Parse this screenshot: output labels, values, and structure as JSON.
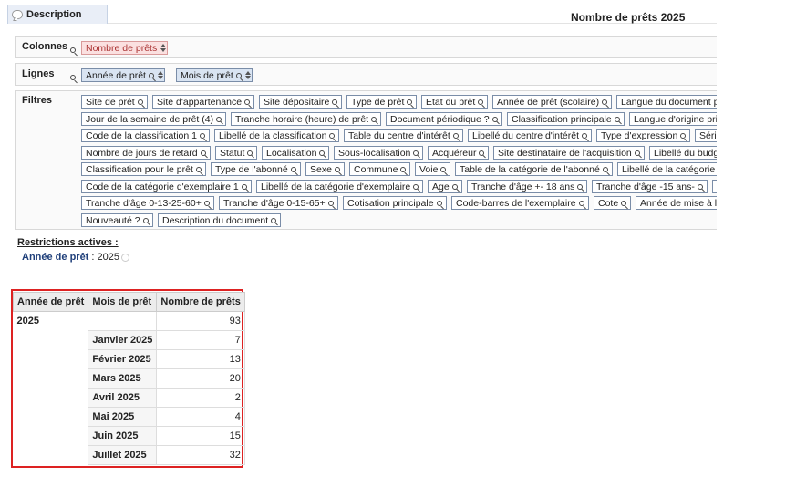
{
  "tab": {
    "description_label": "Description"
  },
  "page_title": "Nombre de prêts 2025",
  "colonnes": {
    "label": "Colonnes",
    "chips": [
      "Nombre de prêts"
    ]
  },
  "lignes": {
    "label": "Lignes",
    "chips": [
      "Année de prêt",
      "Mois de prêt"
    ]
  },
  "filtres": {
    "label": "Filtres",
    "rows": [
      [
        "Site de prêt",
        "Site d'appartenance",
        "Site dépositaire",
        "Type de prêt",
        "Etat du prêt",
        "Année de prêt (scolaire)",
        "Langue du document prêté"
      ],
      [
        "Jour de la semaine de prêt (4)",
        "Tranche horaire (heure) de prêt",
        "Document périodique ?",
        "Classification principale",
        "Langue d'origine principale"
      ],
      [
        "Code de la classification 1",
        "Libellé de la classification",
        "Table du centre d'intérêt",
        "Libellé du centre d'intérêt",
        "Type d'expression",
        "Série"
      ],
      [
        "Nombre de jours de retard",
        "Statut",
        "Localisation",
        "Sous-localisation",
        "Acquéreur",
        "Site destinataire de l'acquisition",
        "Libellé du budget"
      ],
      [
        "Classification pour le prêt",
        "Type de l'abonné",
        "Sexe",
        "Commune",
        "Voie",
        "Table de la catégorie de l'abonné",
        "Libellé de la catégorie"
      ],
      [
        "Code de la catégorie d'exemplaire 1",
        "Libellé de la catégorie d'exemplaire",
        "Age",
        "Tranche d'âge +- 18 ans",
        "Tranche d'âge -15 ans-",
        ""
      ],
      [
        "Tranche d'âge 0-13-25-60+",
        "Tranche d'âge 0-15-65+",
        "Cotisation principale",
        "Code-barres de l'exemplaire",
        "Cote",
        "Année de mise à l'inventaire"
      ],
      [
        "Nouveauté ?",
        "Description du document"
      ]
    ]
  },
  "restrictions": {
    "title": "Restrictions actives :",
    "key": "Année de prêt",
    "sep": " : ",
    "value": "2025"
  },
  "result_table": {
    "headers": [
      "Année de prêt",
      "Mois de prêt",
      "Nombre de prêts"
    ],
    "year": "2025",
    "total": "93",
    "rows": [
      {
        "month": "Janvier 2025",
        "value": "7"
      },
      {
        "month": "Février 2025",
        "value": "13"
      },
      {
        "month": "Mars 2025",
        "value": "20"
      },
      {
        "month": "Avril 2025",
        "value": "2"
      },
      {
        "month": "Mai 2025",
        "value": "4"
      },
      {
        "month": "Juin 2025",
        "value": "15"
      },
      {
        "month": "Juillet 2025",
        "value": "32"
      }
    ]
  }
}
